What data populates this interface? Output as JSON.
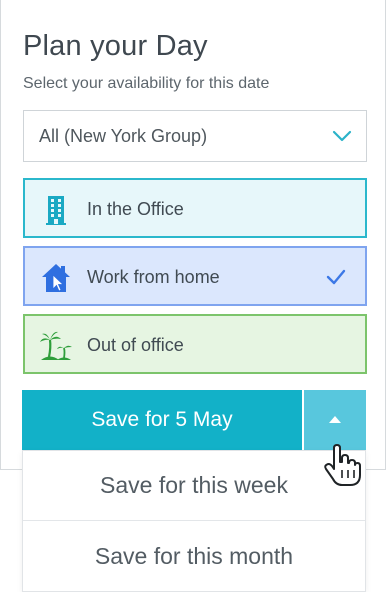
{
  "header": {
    "title": "Plan your Day",
    "subtitle": "Select your availability for this date"
  },
  "group_select": {
    "selected": "All (New York Group)",
    "icon": "chevron-down-icon"
  },
  "options": [
    {
      "label": "In the Office",
      "icon": "office-building-icon",
      "selected": false,
      "color": "#2bb8cc"
    },
    {
      "label": "Work from home",
      "icon": "house-cursor-icon",
      "selected": true,
      "color": "#7fa4ef"
    },
    {
      "label": "Out of office",
      "icon": "palm-island-icon",
      "selected": false,
      "color": "#7cc46b"
    }
  ],
  "save": {
    "label": "Save for 5 May",
    "toggle_icon": "caret-up-icon",
    "color": "#12b1c8"
  },
  "save_menu": {
    "items": [
      "Save for this week",
      "Save for this month"
    ]
  },
  "cursor": "hand-pointer-icon"
}
